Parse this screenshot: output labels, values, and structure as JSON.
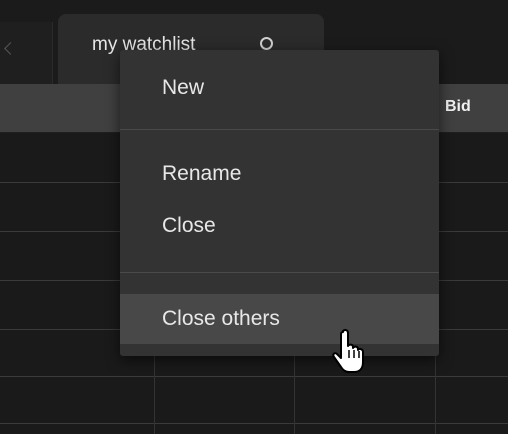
{
  "tabs": [
    {
      "label": "my watchlist",
      "active": true
    }
  ],
  "table": {
    "columns": [
      "Bid"
    ]
  },
  "context_menu": {
    "items": [
      {
        "label": "New"
      },
      {
        "label": "Rename"
      },
      {
        "label": "Close"
      },
      {
        "label": "Close others",
        "highlighted": true
      }
    ]
  },
  "colors": {
    "background": "#1a1a1a",
    "header": "#404040",
    "menu": "#333333",
    "menu_hover": "#484848",
    "text": "#e8e8e8"
  },
  "icons": [
    "search-icon",
    "scroll-left-icon",
    "hand-pointer-icon"
  ]
}
